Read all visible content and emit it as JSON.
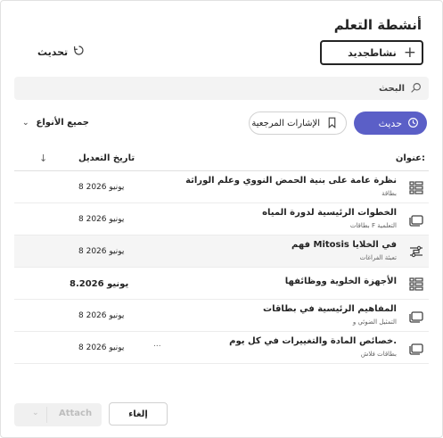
{
  "header": {
    "title": "أنشطة التعلم",
    "new_button_label": "نشاطجديد",
    "refresh_label": "تحديث"
  },
  "search": {
    "placeholder": "البحث"
  },
  "filters": {
    "recent_label": "حديث",
    "bookmarks_label": "الإشارات المرجعية",
    "type_dropdown_label": "جميع الأنواع"
  },
  "table": {
    "col_title": "عنوان:",
    "col_modified": "تاريخ التعديل",
    "rows": [
      {
        "name": "نظرة عامة على بنية الحمض النووي وعلم الوراثة",
        "subtitle": "بطاقة",
        "date": "8 يونيو 2026",
        "icon": "grid-icon"
      },
      {
        "name": "الخطوات الرئيسية لدورة المياه",
        "subtitle": "بطاقات F التعلمية",
        "date": "8 يونيو 2026",
        "icon": "flashcards-icon"
      },
      {
        "name": "فهم Mitosis في الخلايا",
        "subtitle": "تعبئة الفراغات",
        "date": "8 يونيو 2026",
        "icon": "fill-blanks-icon"
      },
      {
        "name": "الأجهزة الخلوية ووظائفها",
        "subtitle": "",
        "date": "8.2026 يونيو",
        "icon": "grid-icon"
      },
      {
        "name": "المفاهيم الرئيسية في بطاقات",
        "subtitle": "التمثيل الضوئي و",
        "date": "8 يونيو 2026",
        "icon": "flashcards-icon"
      },
      {
        "name": "خصائص المادة والتغييرات في كل يوم.",
        "subtitle": "بطاقات فلاش",
        "date": "8 يونيو 2026",
        "icon": "flashcards-icon",
        "extra": "..."
      }
    ]
  },
  "footer": {
    "attach_label": "Attach",
    "cancel_label": "إلغاء"
  },
  "colors": {
    "accent": "#5b5fc7",
    "selected_row": "#f5f5f5"
  }
}
